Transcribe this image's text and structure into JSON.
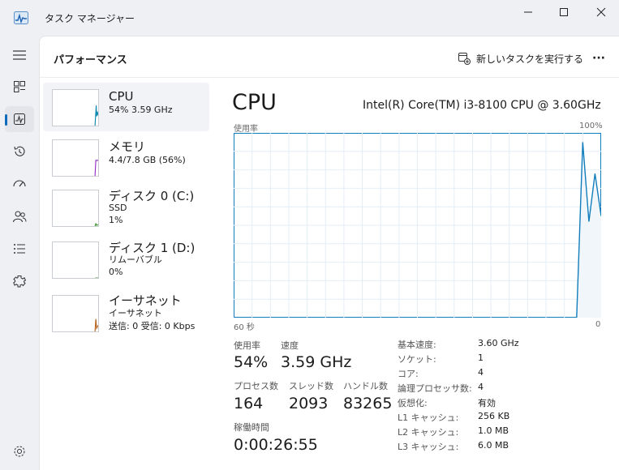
{
  "app": {
    "title": "タスク マネージャー"
  },
  "window_controls": {
    "minimize": "—",
    "maximize": "☐",
    "close": "✕"
  },
  "nav": [
    {
      "name": "hamburger-menu-icon"
    },
    {
      "name": "processes-icon"
    },
    {
      "name": "performance-icon",
      "active": true
    },
    {
      "name": "app-history-icon"
    },
    {
      "name": "startup-apps-icon"
    },
    {
      "name": "users-icon"
    },
    {
      "name": "details-icon"
    },
    {
      "name": "services-icon"
    },
    {
      "name": "settings-icon"
    }
  ],
  "header": {
    "page_title": "パフォーマンス",
    "new_task_label": "新しいタスクを実行する",
    "more_label": "···"
  },
  "resources": [
    {
      "name": "CPU",
      "line1": "54%  3.59 GHz",
      "line2": "",
      "line3": "",
      "color": "#0f8ab0"
    },
    {
      "name": "メモリ",
      "line1": "4.4/7.8 GB (56%)",
      "line2": "",
      "line3": "",
      "color": "#9b30c8"
    },
    {
      "name": "ディスク 0 (C:)",
      "line1": "SSD",
      "line2": "1%",
      "line3": "",
      "color": "#3c9a2a"
    },
    {
      "name": "ディスク 1 (D:)",
      "line1": "リムーバブル",
      "line2": "0%",
      "line3": "",
      "color": "#3c9a2a"
    },
    {
      "name": "イーサネット",
      "line1": "イーサネット",
      "line2": "送信: 0 受信: 0 Kbps",
      "line3": "",
      "color": "#b5651d"
    }
  ],
  "detail": {
    "title": "CPU",
    "model": "Intel(R) Core(TM) i3-8100 CPU @ 3.60GHz",
    "graph_label_top_left": "使用率",
    "graph_label_top_right": "100%",
    "graph_label_bottom_left": "60 秒",
    "graph_label_bottom_right": "0",
    "accent_color": "#117dbb"
  },
  "chart_data": {
    "type": "area",
    "ylabel": "使用率",
    "ylim": [
      0,
      100
    ],
    "xlim": [
      60,
      0
    ],
    "x_unit": "秒",
    "grid": true,
    "series": [
      {
        "x": [
          4,
          3,
          2,
          1,
          0
        ],
        "values": [
          0,
          95,
          52,
          78,
          55
        ]
      }
    ]
  },
  "stats": {
    "usage_label": "使用率",
    "usage_value": "54%",
    "speed_label": "速度",
    "speed_value": "3.59 GHz",
    "processes_label": "プロセス数",
    "processes_value": "164",
    "threads_label": "スレッド数",
    "threads_value": "2093",
    "handles_label": "ハンドル数",
    "handles_value": "83265",
    "uptime_label": "稼働時間",
    "uptime_value": "0:00:26:55"
  },
  "specs": [
    {
      "key": "基本速度:",
      "value": "3.60 GHz"
    },
    {
      "key": "ソケット:",
      "value": "1"
    },
    {
      "key": "コア:",
      "value": "4"
    },
    {
      "key": "論理プロセッサ数:",
      "value": "4"
    },
    {
      "key": "仮想化:",
      "value": "有効"
    },
    {
      "key": "L1 キャッシュ:",
      "value": "256 KB"
    },
    {
      "key": "L2 キャッシュ:",
      "value": "1.0 MB"
    },
    {
      "key": "L3 キャッシュ:",
      "value": "6.0 MB"
    }
  ]
}
